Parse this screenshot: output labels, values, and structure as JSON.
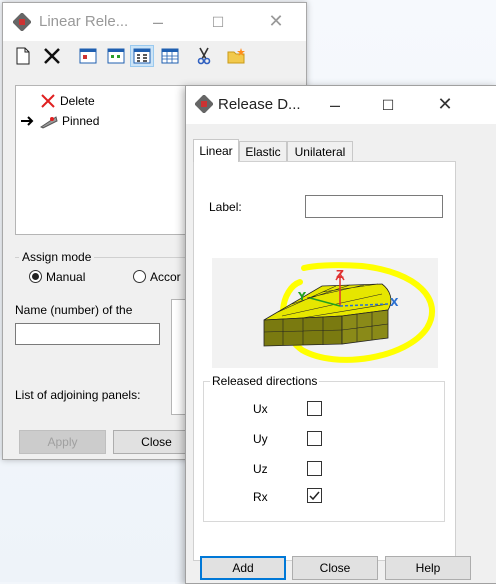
{
  "window_back": {
    "title": "Linear Rele...",
    "tree_items": [
      {
        "label": "Delete"
      },
      {
        "label": "Pinned"
      }
    ],
    "assign_mode": {
      "title": "Assign mode",
      "options": [
        "Manual",
        "Accor"
      ],
      "selected": "Manual"
    },
    "name_label": "Name (number) of the",
    "name_value": "",
    "adjoining_label": "List of adjoining panels:",
    "apply_label": "Apply",
    "close_label": "Close"
  },
  "window_front": {
    "title": "Release D...",
    "tabs": [
      "Linear",
      "Elastic",
      "Unilateral"
    ],
    "active_tab": "Linear",
    "label_caption": "Label:",
    "label_value": "",
    "axes": {
      "z": "Z",
      "y": "Y",
      "x": "X"
    },
    "released_title": "Released directions",
    "directions": [
      {
        "name": "Ux",
        "checked": false
      },
      {
        "name": "Uy",
        "checked": false
      },
      {
        "name": "Uz",
        "checked": false
      },
      {
        "name": "Rx",
        "checked": true
      }
    ],
    "add_label": "Add",
    "close_label": "Close",
    "help_label": "Help"
  },
  "colors": {
    "highlight": "#ffff00",
    "panel_face": "#e6e600",
    "panel_side": "#7a7a10",
    "axis_z": "#e03030",
    "axis_x": "#2a6fd0",
    "axis_y": "#20a020",
    "accent": "#0078d7"
  }
}
